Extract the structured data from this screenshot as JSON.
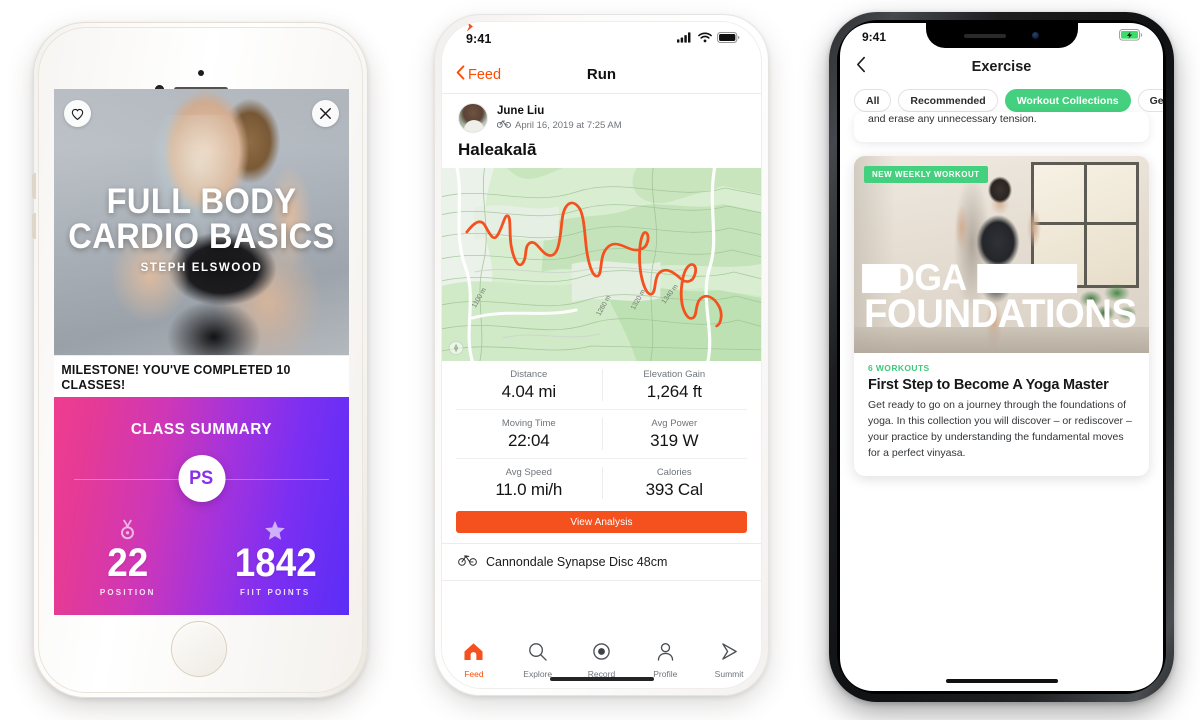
{
  "phone1": {
    "device": "iphone-8-white",
    "hero": {
      "like_icon": "heart-icon",
      "close_icon": "close-icon",
      "title_line1": "FULL BODY",
      "title_line2": "CARDIO BASICS",
      "instructor": "STEPH ELSWOOD"
    },
    "milestone": "MILESTONE! YOU'VE COMPLETED 10 CLASSES!",
    "summary": {
      "title": "CLASS SUMMARY",
      "badge": "PS",
      "stats": [
        {
          "icon": "medal-icon",
          "value": "22",
          "label": "POSITION"
        },
        {
          "icon": "star-icon",
          "value": "1842",
          "label": "FIIT POINTS"
        }
      ]
    },
    "colors": {
      "gradient_start": "#ef3d90",
      "gradient_end": "#5a2ef6",
      "badge_text": "#8b2fe6"
    }
  },
  "phone2": {
    "device": "iphone-x-white",
    "status": {
      "time": "9:41",
      "cellular_icon": "signal-bars-icon",
      "wifi_icon": "wifi-icon",
      "battery_icon": "battery-icon"
    },
    "nav": {
      "back_label": "Feed",
      "back_icon": "chevron-left-icon",
      "title": "Run"
    },
    "post": {
      "author": "June Liu",
      "activity_icon": "bicycle-icon",
      "date": "April 16, 2019 at 7:25 AM",
      "badge_icon": "chevron-badge-icon",
      "title": "Haleakalā"
    },
    "map": {
      "route_color": "#f4511e",
      "contour_labels": [
        "1100 m",
        "1260 m",
        "1320 m",
        "1340 m"
      ],
      "compass_icon": "compass-icon"
    },
    "stats": [
      [
        {
          "label": "Distance",
          "value": "4.04 mi"
        },
        {
          "label": "Elevation Gain",
          "value": "1,264 ft"
        }
      ],
      [
        {
          "label": "Moving Time",
          "value": "22:04"
        },
        {
          "label": "Avg Power",
          "value": "319 W"
        }
      ],
      [
        {
          "label": "Avg Speed",
          "value": "11.0 mi/h"
        },
        {
          "label": "Calories",
          "value": "393 Cal"
        }
      ]
    ],
    "analysis_button": "View Analysis",
    "gear": {
      "icon": "bicycle-icon",
      "name": "Cannondale Synapse Disc 48cm"
    },
    "tabs": [
      {
        "label": "Feed",
        "icon": "home-icon",
        "active": true
      },
      {
        "label": "Explore",
        "icon": "search-icon",
        "active": false
      },
      {
        "label": "Record",
        "icon": "record-icon",
        "active": false
      },
      {
        "label": "Profile",
        "icon": "person-icon",
        "active": false
      },
      {
        "label": "Summit",
        "icon": "chevron-badge-icon",
        "active": false
      }
    ],
    "colors": {
      "accent": "#f4511e",
      "map_green": "#cdeac4"
    }
  },
  "phone3": {
    "device": "iphone-x-black",
    "status": {
      "time": "9:41",
      "battery_icon": "battery-charging-icon"
    },
    "nav": {
      "back_icon": "chevron-left-icon",
      "title": "Exercise"
    },
    "chips": [
      {
        "label": "All",
        "active": false
      },
      {
        "label": "Recommended",
        "active": false
      },
      {
        "label": "Workout Collections",
        "active": true
      },
      {
        "label": "Get",
        "active": false
      }
    ],
    "peek_card_text": "and erase any unnecessary tension.",
    "featured": {
      "badge": "NEW WEEKLY WORKOUT",
      "overlay_line1": "YOGA",
      "overlay_line2": "FOUNDATIONS",
      "kicker": "6 WORKOUTS",
      "title": "First Step to Become A Yoga Master",
      "description": "Get ready to go on a journey through the foundations of yoga. In this collection you will discover – or rediscover – your practice by understanding the fundamental moves for a perfect vinyasa."
    },
    "colors": {
      "accent": "#44d07e",
      "battery": "#3ddc6a"
    }
  }
}
